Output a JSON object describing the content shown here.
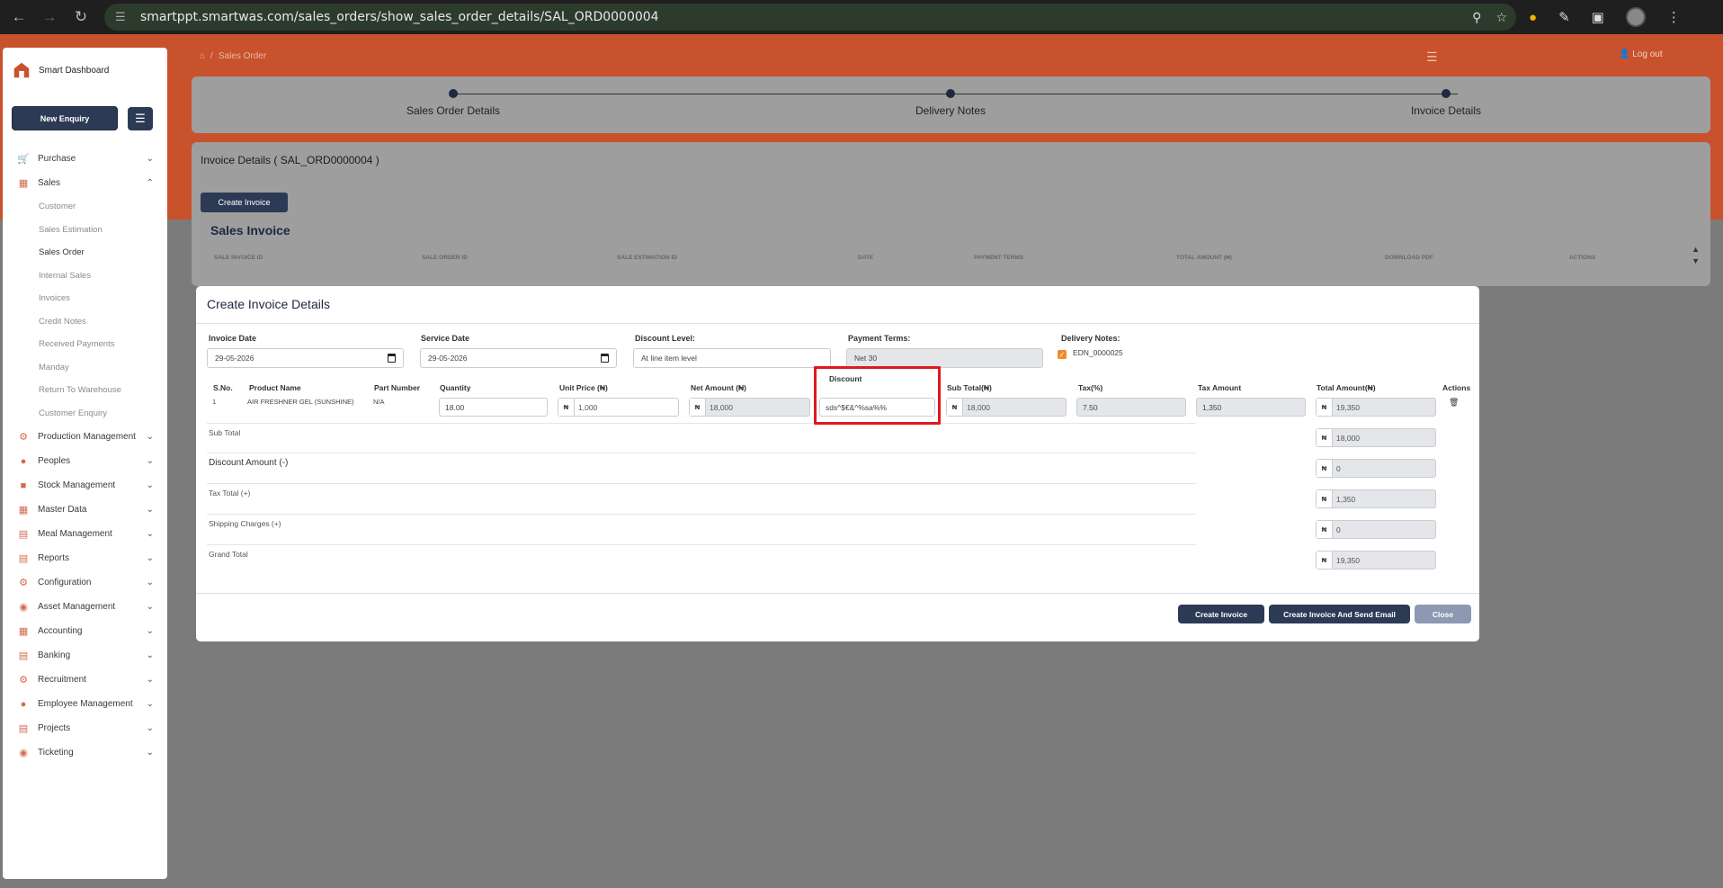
{
  "browser": {
    "url": "smartppt.smartwas.com/sales_orders/show_sales_order_details/SAL_ORD0000004"
  },
  "sidebar": {
    "brand": "Smart Dashboard",
    "new_enquiry": "New Enquiry",
    "items": [
      {
        "label": "Purchase",
        "icon": "cart-icon"
      },
      {
        "label": "Sales",
        "icon": "sales-icon"
      },
      {
        "label": "Production Management",
        "icon": "factory-icon"
      },
      {
        "label": "Peoples",
        "icon": "people-icon"
      },
      {
        "label": "Stock Management",
        "icon": "stock-icon"
      },
      {
        "label": "Master Data",
        "icon": "database-icon"
      },
      {
        "label": "Meal Management",
        "icon": "meal-icon"
      },
      {
        "label": "Reports",
        "icon": "report-icon"
      },
      {
        "label": "Configuration",
        "icon": "config-icon"
      },
      {
        "label": "Asset Management",
        "icon": "asset-icon"
      },
      {
        "label": "Accounting",
        "icon": "accounting-icon"
      },
      {
        "label": "Banking",
        "icon": "bank-icon"
      },
      {
        "label": "Recruitment",
        "icon": "recruitment-icon"
      },
      {
        "label": "Employee Management",
        "icon": "employee-icon"
      },
      {
        "label": "Projects",
        "icon": "projects-icon"
      },
      {
        "label": "Ticketing",
        "icon": "ticket-icon"
      }
    ],
    "sales_sub": [
      "Customer",
      "Sales Estimation",
      "Sales Order",
      "Internal Sales",
      "Invoices",
      "Credit Notes",
      "Received Payments",
      "Manday",
      "Return To Warehouse",
      "Customer Enquiry"
    ],
    "accent": "#c8522c"
  },
  "header": {
    "breadcrumb": "Sales Order",
    "logout": "Log out"
  },
  "stepper": {
    "steps": [
      "Sales Order Details",
      "Delivery Notes",
      "Invoice Details"
    ]
  },
  "invoice_panel": {
    "title": "Invoice Details ( SAL_ORD0000004 )",
    "create_button": "Create Invoice",
    "section_title": "Sales Invoice",
    "columns": [
      "SALE INVOICE ID",
      "SALE ORDER ID",
      "SALE ESTIMATION ID",
      "DATE",
      "PAYMENT TERMS",
      "TOTAL AMOUNT (₦)",
      "DOWNLOAD PDF",
      "ACTIONS"
    ]
  },
  "modal": {
    "title": "Create Invoice Details",
    "invoice_date_label": "Invoice Date",
    "invoice_date": "29-05-2026",
    "service_date_label": "Service Date",
    "service_date": "29-05-2026",
    "discount_level_label": "Discount Level:",
    "discount_level": "At line item level",
    "payment_terms_label": "Payment Terms:",
    "payment_terms": "Net 30",
    "delivery_notes_label": "Delivery Notes:",
    "delivery_note": "EDN_0000025",
    "columns": {
      "sno": "S.No.",
      "product": "Product Name",
      "part": "Part Number",
      "qty": "Quantity",
      "unit_price": "Unit Price (₦)",
      "net_amount": "Net Amount (₦)",
      "discount": "Discount",
      "sub_total": "Sub Total(₦)",
      "tax_pct": "Tax(%)",
      "tax_amount": "Tax Amount",
      "total_amount": "Total Amount(₦)",
      "actions": "Actions"
    },
    "row": {
      "sno": "1",
      "product": "AIR FRESHNER GEL (SUNSHINE)",
      "part": "N/A",
      "qty": "18.00",
      "unit_price": "1,000",
      "net_amount": "18,000",
      "discount": "sds^$€&^%sa%%",
      "sub_total": "18,000",
      "tax_pct": "7.50",
      "tax_amount": "1,350",
      "total_amount": "19,350"
    },
    "currency": "₦",
    "summary": {
      "sub_total_label": "Sub Total",
      "sub_total": "18,000",
      "discount_label": "Discount Amount (-)",
      "discount": "0",
      "tax_label": "Tax Total (+)",
      "tax": "1,350",
      "shipping_label": "Shipping Charges (+)",
      "shipping": "0",
      "grand_label": "Grand Total",
      "grand": "19,350"
    },
    "buttons": {
      "create": "Create Invoice",
      "create_email": "Create Invoice And Send Email",
      "close": "Close"
    }
  }
}
